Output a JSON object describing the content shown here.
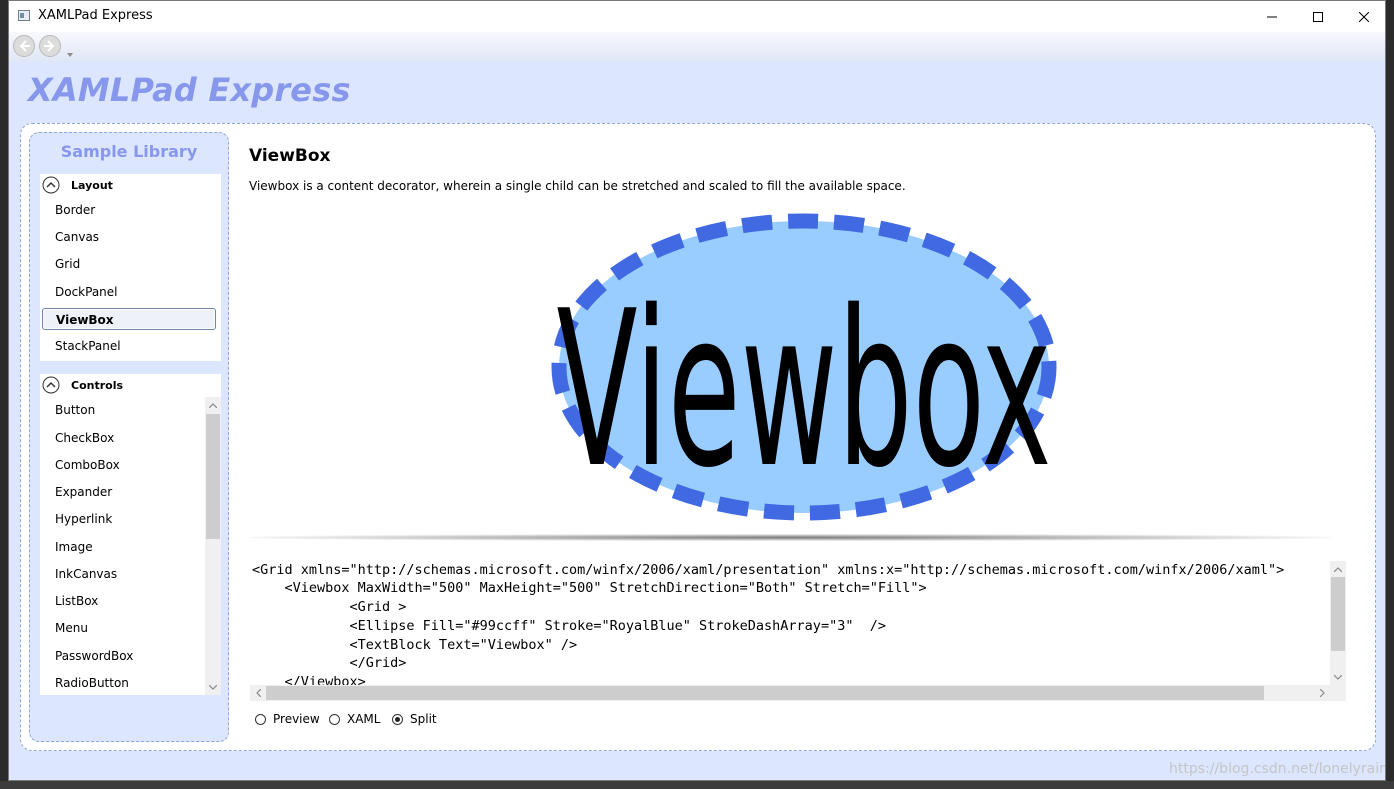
{
  "window": {
    "title": "XAMLPad Express",
    "app_title": "XAMLPad Express"
  },
  "sidebar": {
    "title": "Sample Library",
    "groups": [
      {
        "label": "Layout",
        "items": [
          "Border",
          "Canvas",
          "Grid",
          "DockPanel",
          "ViewBox",
          "StackPanel"
        ],
        "selected": "ViewBox"
      },
      {
        "label": "Controls",
        "items": [
          "Button",
          "CheckBox",
          "ComboBox",
          "Expander",
          "Hyperlink",
          "Image",
          "InkCanvas",
          "ListBox",
          "Menu",
          "PasswordBox",
          "RadioButton"
        ]
      }
    ]
  },
  "content": {
    "title": "ViewBox",
    "description": "Viewbox is a content decorator, wherein a single child can be stretched and scaled to fill the available space.",
    "preview": {
      "text": "Viewbox",
      "ellipse_fill": "#99ccff",
      "ellipse_stroke": "#4169e1"
    },
    "code_lines": [
      "<Grid xmlns=\"http://schemas.microsoft.com/winfx/2006/xaml/presentation\" xmlns:x=\"http://schemas.microsoft.com/winfx/2006/xaml\">",
      "    <Viewbox MaxWidth=\"500\" MaxHeight=\"500\" StretchDirection=\"Both\" Stretch=\"Fill\">",
      "            <Grid >",
      "            <Ellipse Fill=\"#99ccff\" Stroke=\"RoyalBlue\" StrokeDashArray=\"3\"  />",
      "            <TextBlock Text=\"Viewbox\" />",
      "            </Grid>",
      "    </Viewbox>"
    ],
    "view_modes": [
      {
        "label": "Preview",
        "checked": false
      },
      {
        "label": "XAML",
        "checked": false
      },
      {
        "label": "Split",
        "checked": true
      }
    ]
  },
  "watermark": "https://blog.csdn.net/lonelyrains"
}
